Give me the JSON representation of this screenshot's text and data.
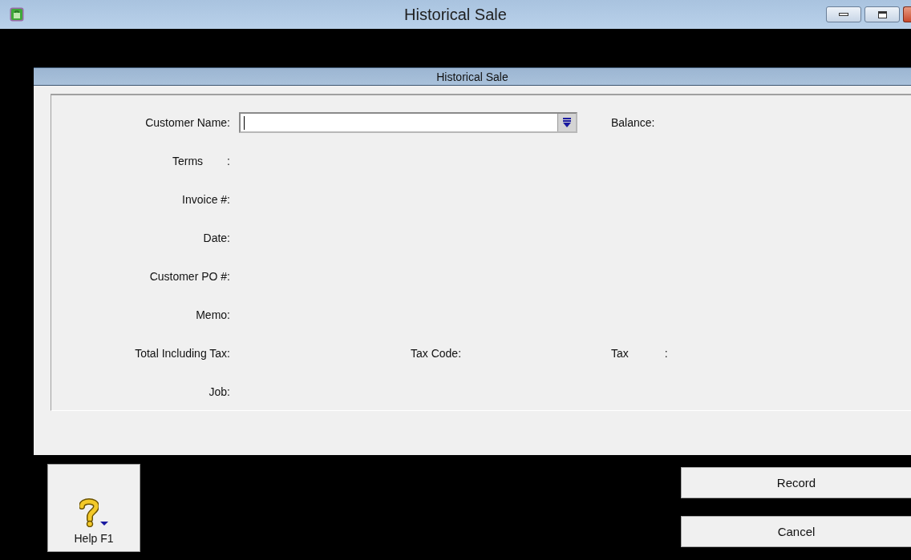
{
  "window": {
    "title": "Historical Sale"
  },
  "header": {
    "title": "Historical Sale"
  },
  "fields": [
    {
      "kind": "combo",
      "label": "Customer Name:",
      "focused": true,
      "side_label": "Balance:"
    },
    {
      "kind": "label",
      "label": "Terms",
      "separator": ":"
    },
    {
      "kind": "label",
      "label": "Invoice #:"
    },
    {
      "kind": "label",
      "label": "Date:"
    },
    {
      "kind": "label",
      "label": "Customer PO #:"
    },
    {
      "kind": "label",
      "label": "Memo:"
    },
    {
      "kind": "totals",
      "label": "Total Including Tax:",
      "middle_label": "Tax Code:",
      "side_label": "Tax",
      "side_separator": ":"
    },
    {
      "kind": "label",
      "label": "Job:"
    }
  ],
  "help_button": {
    "label": "Help F1"
  },
  "buttons": [
    "Record",
    "Cancel"
  ]
}
